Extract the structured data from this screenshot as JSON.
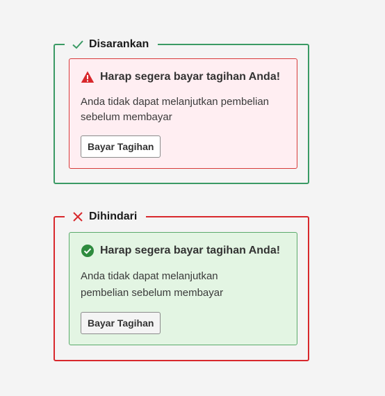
{
  "recommended": {
    "label": "Disarankan",
    "icon": "check-icon",
    "border_color": "#3a9a64",
    "alert": {
      "variant": "danger",
      "icon": "warning-icon",
      "background": "#ffeef2",
      "border_color": "#d83a3a",
      "title": "Harap segera bayar tagihan Anda!",
      "body": "Anda tidak dapat melanjutkan pembelian sebelum membayar",
      "button_label": "Bayar Tagihan"
    }
  },
  "avoided": {
    "label": "Dihindari",
    "icon": "close-icon",
    "border_color": "#d8282c",
    "alert": {
      "variant": "success",
      "icon": "check-circle-icon",
      "background": "#e3f5e3",
      "border_color": "#5aaa6a",
      "title": "Harap segera bayar tagihan Anda!",
      "body": "Anda tidak dapat melanjutkan pembelian sebelum membayar",
      "button_label": "Bayar Tagihan"
    }
  }
}
